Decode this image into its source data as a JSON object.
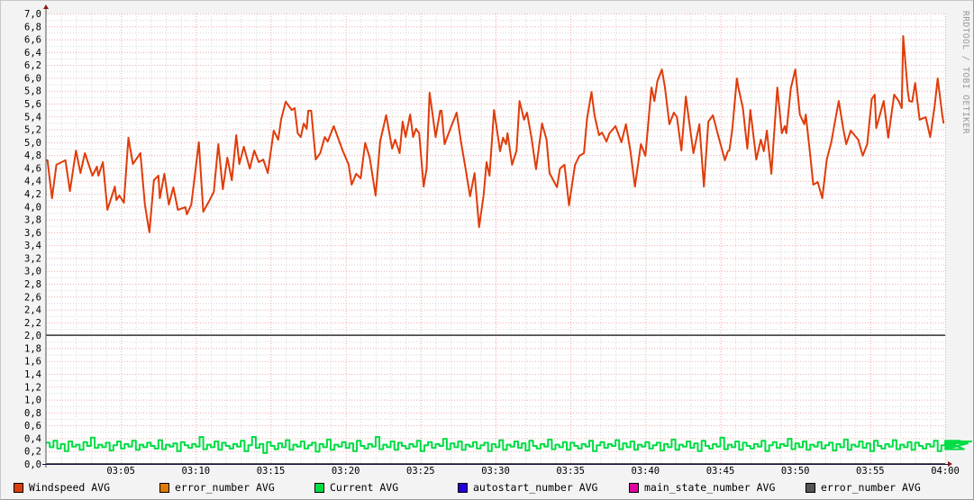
{
  "watermark": "RRDTOOL / TOBI OETIKER",
  "chart_data": {
    "type": "line",
    "title": "",
    "xlabel": "",
    "ylabel": "",
    "ylim": [
      0,
      7.0
    ],
    "xlim_minutes": [
      0,
      60
    ],
    "x_unit": "minutes after 03:00",
    "grid": true,
    "y_ticks": [
      "0,0",
      "0,2",
      "0,4",
      "0,6",
      "0,8",
      "1,0",
      "1,2",
      "1,4",
      "1,6",
      "1,8",
      "2,0",
      "2,2",
      "2,4",
      "2,6",
      "2,8",
      "3,0",
      "3,2",
      "3,4",
      "3,6",
      "3,8",
      "4,0",
      "4,2",
      "4,4",
      "4,6",
      "4,8",
      "5,0",
      "5,2",
      "5,4",
      "5,6",
      "5,8",
      "6,0",
      "6,2",
      "6,4",
      "6,6",
      "6,8",
      "7,0"
    ],
    "x_ticks": [
      {
        "minute": 5,
        "label": "03:05"
      },
      {
        "minute": 10,
        "label": "03:10"
      },
      {
        "minute": 15,
        "label": "03:15"
      },
      {
        "minute": 20,
        "label": "03:20"
      },
      {
        "minute": 25,
        "label": "03:25"
      },
      {
        "minute": 30,
        "label": "03:30"
      },
      {
        "minute": 35,
        "label": "03:35"
      },
      {
        "minute": 40,
        "label": "03:40"
      },
      {
        "minute": 45,
        "label": "03:45"
      },
      {
        "minute": 50,
        "label": "03:50"
      },
      {
        "minute": 55,
        "label": "03:55"
      },
      {
        "minute": 60,
        "label": "04:00"
      }
    ],
    "hrule": {
      "value": 2.0,
      "color": "#333333"
    },
    "legend_position": "bottom",
    "series": [
      {
        "name": "Windspeed AVG",
        "color": "#e03c0a",
        "points": [
          [
            0,
            4.72
          ],
          [
            0.1,
            4.72
          ],
          [
            0.4,
            4.13
          ],
          [
            0.7,
            4.65
          ],
          [
            1.3,
            4.72
          ],
          [
            1.6,
            4.24
          ],
          [
            2.0,
            4.87
          ],
          [
            2.3,
            4.52
          ],
          [
            2.6,
            4.83
          ],
          [
            3.1,
            4.48
          ],
          [
            3.4,
            4.62
          ],
          [
            3.5,
            4.48
          ],
          [
            3.8,
            4.69
          ],
          [
            4.1,
            3.95
          ],
          [
            4.6,
            4.31
          ],
          [
            4.7,
            4.1
          ],
          [
            4.9,
            4.17
          ],
          [
            5.2,
            4.06
          ],
          [
            5.5,
            5.07
          ],
          [
            5.8,
            4.66
          ],
          [
            6.3,
            4.83
          ],
          [
            6.6,
            4.03
          ],
          [
            6.9,
            3.6
          ],
          [
            7.2,
            4.41
          ],
          [
            7.5,
            4.48
          ],
          [
            7.6,
            4.13
          ],
          [
            7.9,
            4.51
          ],
          [
            8.2,
            4.03
          ],
          [
            8.5,
            4.3
          ],
          [
            8.8,
            3.95
          ],
          [
            9.3,
            3.99
          ],
          [
            9.4,
            3.88
          ],
          [
            9.7,
            4.03
          ],
          [
            10.2,
            5.0
          ],
          [
            10.5,
            3.92
          ],
          [
            10.9,
            4.09
          ],
          [
            11.2,
            4.23
          ],
          [
            11.5,
            4.97
          ],
          [
            11.8,
            4.27
          ],
          [
            12.1,
            4.76
          ],
          [
            12.4,
            4.41
          ],
          [
            12.7,
            5.11
          ],
          [
            12.9,
            4.66
          ],
          [
            13.2,
            4.93
          ],
          [
            13.6,
            4.59
          ],
          [
            13.9,
            4.87
          ],
          [
            14.2,
            4.69
          ],
          [
            14.5,
            4.73
          ],
          [
            14.8,
            4.52
          ],
          [
            15.2,
            5.18
          ],
          [
            15.5,
            5.04
          ],
          [
            15.7,
            5.36
          ],
          [
            16.0,
            5.63
          ],
          [
            16.4,
            5.5
          ],
          [
            16.6,
            5.53
          ],
          [
            16.8,
            5.14
          ],
          [
            17.0,
            5.08
          ],
          [
            17.2,
            5.29
          ],
          [
            17.4,
            5.21
          ],
          [
            17.5,
            5.49
          ],
          [
            17.7,
            5.49
          ],
          [
            18.0,
            4.73
          ],
          [
            18.3,
            4.83
          ],
          [
            18.6,
            5.08
          ],
          [
            18.8,
            5.01
          ],
          [
            19.2,
            5.25
          ],
          [
            19.8,
            4.87
          ],
          [
            20.2,
            4.65
          ],
          [
            20.4,
            4.34
          ],
          [
            20.7,
            4.51
          ],
          [
            21.0,
            4.44
          ],
          [
            21.3,
            4.99
          ],
          [
            21.6,
            4.76
          ],
          [
            22.0,
            4.17
          ],
          [
            22.3,
            5.01
          ],
          [
            22.7,
            5.42
          ],
          [
            23.1,
            4.9
          ],
          [
            23.3,
            5.04
          ],
          [
            23.6,
            4.83
          ],
          [
            23.8,
            5.32
          ],
          [
            24.0,
            5.08
          ],
          [
            24.3,
            5.43
          ],
          [
            24.5,
            5.08
          ],
          [
            24.7,
            5.21
          ],
          [
            24.9,
            5.14
          ],
          [
            25.2,
            4.31
          ],
          [
            25.4,
            4.59
          ],
          [
            25.6,
            5.77
          ],
          [
            25.8,
            5.43
          ],
          [
            26.0,
            5.08
          ],
          [
            26.3,
            5.49
          ],
          [
            26.4,
            5.49
          ],
          [
            26.6,
            4.97
          ],
          [
            27.0,
            5.22
          ],
          [
            27.4,
            5.46
          ],
          [
            27.7,
            5.0
          ],
          [
            28.0,
            4.59
          ],
          [
            28.3,
            4.16
          ],
          [
            28.6,
            4.52
          ],
          [
            28.9,
            3.68
          ],
          [
            29.2,
            4.17
          ],
          [
            29.4,
            4.69
          ],
          [
            29.6,
            4.48
          ],
          [
            29.9,
            5.5
          ],
          [
            30.1,
            5.18
          ],
          [
            30.3,
            4.86
          ],
          [
            30.5,
            5.07
          ],
          [
            30.7,
            4.97
          ],
          [
            30.8,
            5.14
          ],
          [
            31.1,
            4.65
          ],
          [
            31.4,
            4.87
          ],
          [
            31.6,
            5.64
          ],
          [
            31.9,
            5.35
          ],
          [
            32.1,
            5.46
          ],
          [
            32.4,
            5.07
          ],
          [
            32.7,
            4.58
          ],
          [
            33.1,
            5.29
          ],
          [
            33.4,
            5.04
          ],
          [
            33.6,
            4.52
          ],
          [
            34.1,
            4.3
          ],
          [
            34.3,
            4.59
          ],
          [
            34.6,
            4.65
          ],
          [
            34.9,
            4.02
          ],
          [
            35.3,
            4.65
          ],
          [
            35.6,
            4.79
          ],
          [
            35.9,
            4.83
          ],
          [
            36.1,
            5.36
          ],
          [
            36.4,
            5.78
          ],
          [
            36.6,
            5.42
          ],
          [
            36.9,
            5.11
          ],
          [
            37.1,
            5.15
          ],
          [
            37.4,
            5.01
          ],
          [
            37.6,
            5.14
          ],
          [
            38.0,
            5.25
          ],
          [
            38.4,
            5.0
          ],
          [
            38.7,
            5.28
          ],
          [
            39.0,
            4.86
          ],
          [
            39.3,
            4.31
          ],
          [
            39.7,
            4.97
          ],
          [
            40.0,
            4.79
          ],
          [
            40.4,
            5.85
          ],
          [
            40.6,
            5.64
          ],
          [
            40.8,
            5.95
          ],
          [
            41.1,
            6.13
          ],
          [
            41.3,
            5.85
          ],
          [
            41.6,
            5.28
          ],
          [
            41.9,
            5.46
          ],
          [
            42.1,
            5.39
          ],
          [
            42.4,
            4.87
          ],
          [
            42.7,
            5.71
          ],
          [
            42.9,
            5.35
          ],
          [
            43.2,
            4.83
          ],
          [
            43.6,
            5.28
          ],
          [
            43.9,
            4.31
          ],
          [
            44.2,
            5.32
          ],
          [
            44.5,
            5.42
          ],
          [
            44.8,
            5.15
          ],
          [
            45.3,
            4.72
          ],
          [
            45.5,
            4.86
          ],
          [
            45.6,
            4.87
          ],
          [
            45.8,
            5.21
          ],
          [
            46.1,
            5.99
          ],
          [
            46.2,
            5.85
          ],
          [
            46.5,
            5.53
          ],
          [
            46.8,
            4.9
          ],
          [
            47.0,
            5.5
          ],
          [
            47.4,
            4.73
          ],
          [
            47.7,
            5.04
          ],
          [
            47.9,
            4.86
          ],
          [
            48.1,
            5.18
          ],
          [
            48.4,
            4.51
          ],
          [
            48.8,
            5.85
          ],
          [
            49.1,
            5.14
          ],
          [
            49.3,
            5.25
          ],
          [
            49.4,
            5.14
          ],
          [
            49.7,
            5.84
          ],
          [
            50.0,
            6.13
          ],
          [
            50.3,
            5.43
          ],
          [
            50.6,
            5.28
          ],
          [
            50.7,
            5.43
          ],
          [
            51.0,
            4.79
          ],
          [
            51.2,
            4.34
          ],
          [
            51.5,
            4.38
          ],
          [
            51.8,
            4.13
          ],
          [
            52.1,
            4.73
          ],
          [
            52.4,
            5.0
          ],
          [
            52.7,
            5.39
          ],
          [
            52.9,
            5.64
          ],
          [
            53.2,
            5.21
          ],
          [
            53.4,
            4.97
          ],
          [
            53.7,
            5.18
          ],
          [
            54.2,
            5.04
          ],
          [
            54.5,
            4.79
          ],
          [
            54.8,
            4.97
          ],
          [
            55.1,
            5.67
          ],
          [
            55.3,
            5.74
          ],
          [
            55.4,
            5.22
          ],
          [
            55.9,
            5.64
          ],
          [
            56.2,
            5.07
          ],
          [
            56.6,
            5.74
          ],
          [
            56.9,
            5.64
          ],
          [
            57.1,
            5.53
          ],
          [
            57.2,
            6.65
          ],
          [
            57.5,
            5.81
          ],
          [
            57.6,
            5.64
          ],
          [
            57.8,
            5.63
          ],
          [
            58.0,
            5.92
          ],
          [
            58.3,
            5.35
          ],
          [
            58.7,
            5.39
          ],
          [
            59.0,
            5.08
          ],
          [
            59.3,
            5.57
          ],
          [
            59.5,
            5.99
          ],
          [
            59.8,
            5.43
          ],
          [
            59.9,
            5.29
          ]
        ]
      },
      {
        "name": "error_number AVG",
        "color": "#e07a00",
        "points": [
          [
            0,
            0
          ],
          [
            60,
            0
          ]
        ]
      },
      {
        "name": "Current AVG",
        "color": "#00dd44",
        "step_minutes": 0.25,
        "values": [
          0.33,
          0.26,
          0.36,
          0.24,
          0.31,
          0.2,
          0.35,
          0.27,
          0.3,
          0.22,
          0.34,
          0.28,
          0.41,
          0.25,
          0.3,
          0.26,
          0.33,
          0.21,
          0.29,
          0.35,
          0.24,
          0.31,
          0.27,
          0.36,
          0.22,
          0.3,
          0.26,
          0.33,
          0.28,
          0.24,
          0.37,
          0.23,
          0.3,
          0.27,
          0.32,
          0.2,
          0.34,
          0.29,
          0.25,
          0.31,
          0.27,
          0.42,
          0.23,
          0.3,
          0.26,
          0.35,
          0.22,
          0.33,
          0.28,
          0.24,
          0.31,
          0.27,
          0.36,
          0.2,
          0.29,
          0.42,
          0.25,
          0.31,
          0.17,
          0.34,
          0.28,
          0.23,
          0.32,
          0.26,
          0.37,
          0.22,
          0.3,
          0.27,
          0.35,
          0.24,
          0.29,
          0.33,
          0.19,
          0.31,
          0.26,
          0.38,
          0.22,
          0.3,
          0.27,
          0.34,
          0.25,
          0.32,
          0.2,
          0.36,
          0.28,
          0.24,
          0.31,
          0.27,
          0.42,
          0.23,
          0.3,
          0.26,
          0.35,
          0.22,
          0.33,
          0.28,
          0.24,
          0.31,
          0.27,
          0.36,
          0.2,
          0.29,
          0.34,
          0.25,
          0.31,
          0.28,
          0.39,
          0.23,
          0.32,
          0.26,
          0.35,
          0.22,
          0.3,
          0.27,
          0.34,
          0.24,
          0.29,
          0.33,
          0.2,
          0.31,
          0.26,
          0.37,
          0.22,
          0.3,
          0.27,
          0.35,
          0.25,
          0.32,
          0.21,
          0.36,
          0.28,
          0.24,
          0.31,
          0.27,
          0.38,
          0.23,
          0.3,
          0.26,
          0.34,
          0.22,
          0.33,
          0.28,
          0.24,
          0.31,
          0.27,
          0.36,
          0.2,
          0.29,
          0.34,
          0.25,
          0.31,
          0.28,
          0.37,
          0.23,
          0.32,
          0.26,
          0.35,
          0.22,
          0.3,
          0.27,
          0.34,
          0.24,
          0.29,
          0.33,
          0.21,
          0.31,
          0.26,
          0.38,
          0.22,
          0.3,
          0.27,
          0.35,
          0.25,
          0.32,
          0.2,
          0.36,
          0.28,
          0.24,
          0.31,
          0.27,
          0.41,
          0.23,
          0.3,
          0.26,
          0.35,
          0.22,
          0.33,
          0.28,
          0.24,
          0.31,
          0.27,
          0.36,
          0.2,
          0.29,
          0.34,
          0.25,
          0.31,
          0.28,
          0.39,
          0.23,
          0.32,
          0.26,
          0.35,
          0.22,
          0.3,
          0.27,
          0.34,
          0.24,
          0.29,
          0.33,
          0.21,
          0.31,
          0.26,
          0.38,
          0.22,
          0.3,
          0.27,
          0.35,
          0.25,
          0.32,
          0.2,
          0.36,
          0.28,
          0.24,
          0.31,
          0.27,
          0.37,
          0.23,
          0.3,
          0.26,
          0.34,
          0.22,
          0.33,
          0.28,
          0.24,
          0.31,
          0.27,
          0.36,
          0.2,
          0.29,
          0.34,
          0.25,
          0.31,
          0.28,
          0.36,
          0.23,
          0.32,
          0.35
        ]
      },
      {
        "name": "autostart_number AVG",
        "color": "#2200dd",
        "points": [
          [
            0,
            0
          ],
          [
            60,
            0
          ]
        ]
      },
      {
        "name": "main_state_number AVG",
        "color": "#e000a0",
        "points": [
          [
            0,
            0
          ],
          [
            60,
            0
          ]
        ]
      },
      {
        "name": "error_number AVG",
        "color": "#555555",
        "points": [
          [
            0,
            0
          ],
          [
            60,
            0
          ]
        ]
      }
    ]
  }
}
